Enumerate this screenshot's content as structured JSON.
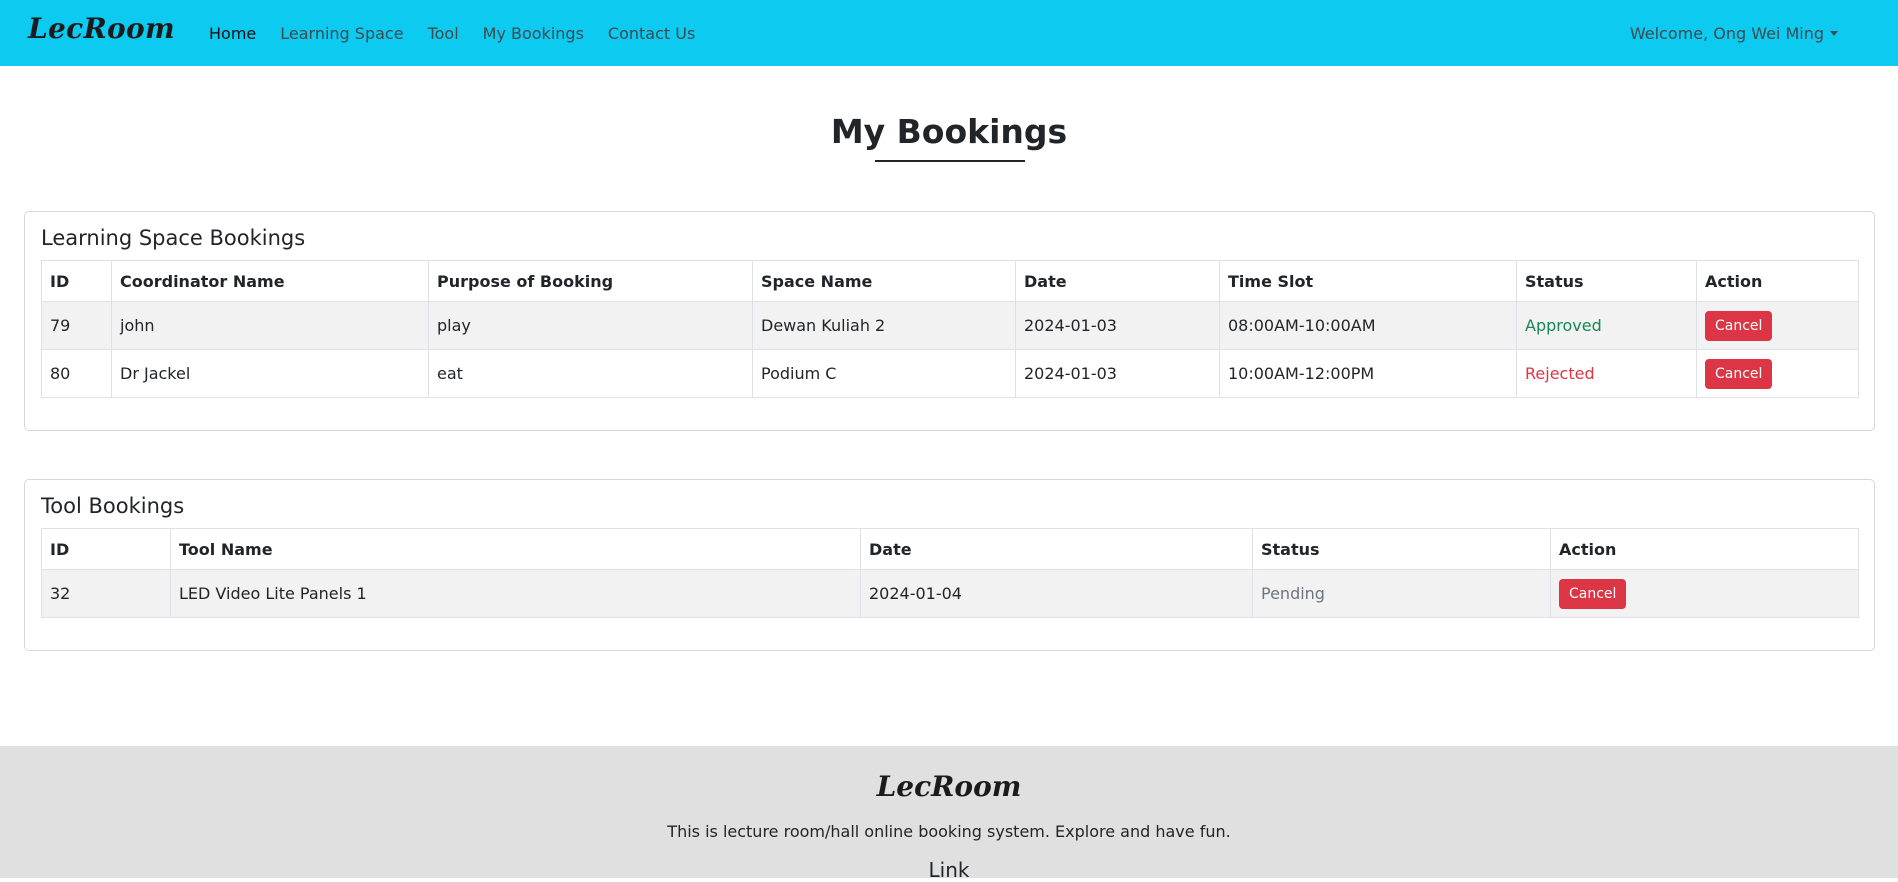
{
  "navbar": {
    "brand": "LecRoom",
    "links": [
      {
        "label": "Home"
      },
      {
        "label": "Learning Space"
      },
      {
        "label": "Tool"
      },
      {
        "label": "My Bookings"
      },
      {
        "label": "Contact Us"
      }
    ],
    "user_menu": "Welcome, Ong Wei Ming"
  },
  "page": {
    "title": "My Bookings"
  },
  "learning_space": {
    "title": "Learning Space Bookings",
    "columns": [
      "ID",
      "Coordinator Name",
      "Purpose of Booking",
      "Space Name",
      "Date",
      "Time Slot",
      "Status",
      "Action"
    ],
    "rows": [
      {
        "id": "79",
        "coordinator": "john",
        "purpose": "play",
        "space": "Dewan Kuliah 2",
        "date": "2024-01-03",
        "time_slot": "08:00AM-10:00AM",
        "status": "Approved",
        "action": "Cancel"
      },
      {
        "id": "80",
        "coordinator": "Dr Jackel",
        "purpose": "eat",
        "space": "Podium C",
        "date": "2024-01-03",
        "time_slot": "10:00AM-12:00PM",
        "status": "Rejected",
        "action": "Cancel"
      }
    ]
  },
  "tool": {
    "title": "Tool Bookings",
    "columns": [
      "ID",
      "Tool Name",
      "Date",
      "Status",
      "Action"
    ],
    "rows": [
      {
        "id": "32",
        "tool_name": "LED Video Lite Panels 1",
        "date": "2024-01-04",
        "status": "Pending",
        "action": "Cancel"
      }
    ]
  },
  "footer": {
    "brand": "LecRoom",
    "description": "This is lecture room/hall online booking system. Explore and have fun.",
    "link_heading": "Link"
  },
  "colors": {
    "navbar_bg": "#0dcaf0",
    "approved": "#198754",
    "rejected": "#dc3545",
    "pending": "#6c757d",
    "danger_button": "#dc3545",
    "footer_bg": "#e0e0e0"
  }
}
